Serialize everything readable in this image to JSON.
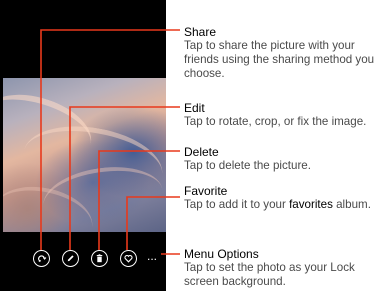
{
  "toolbar": {
    "buttons": [
      {
        "name": "share",
        "icon": "share-icon"
      },
      {
        "name": "edit",
        "icon": "pencil-icon"
      },
      {
        "name": "delete",
        "icon": "trash-icon"
      },
      {
        "name": "favorite",
        "icon": "heart-icon"
      },
      {
        "name": "menu-options",
        "icon": "ellipsis-icon",
        "label": "..."
      }
    ]
  },
  "annotations": {
    "share": {
      "title": "Share",
      "desc": "Tap to share the picture with your friends using the sharing method you choose."
    },
    "edit": {
      "title": "Edit",
      "desc": "Tap to rotate, crop, or fix the image."
    },
    "delete": {
      "title": "Delete",
      "desc": "Tap to delete the picture."
    },
    "favorite": {
      "title": "Favorite",
      "desc_before": "Tap to add it to your ",
      "desc_bold": "favorites",
      "desc_after": " album."
    },
    "menu": {
      "title": "Menu Options",
      "desc": "Tap to set the photo as your Lock screen background."
    }
  },
  "colors": {
    "callout_line": "#e8391c",
    "phone_background": "#000000",
    "icon_color": "#ffffff"
  }
}
